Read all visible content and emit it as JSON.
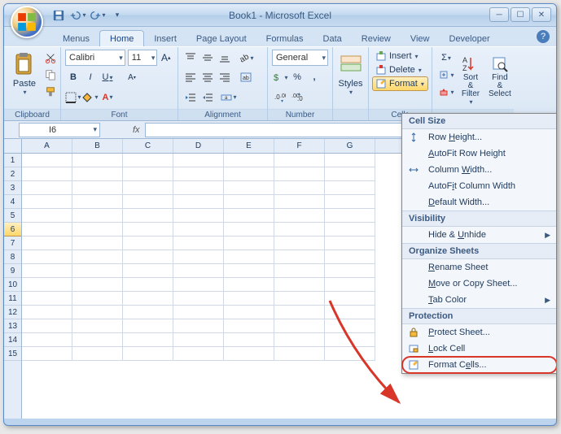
{
  "title": "Book1 - Microsoft Excel",
  "tabs": [
    "Menus",
    "Home",
    "Insert",
    "Page Layout",
    "Formulas",
    "Data",
    "Review",
    "View",
    "Developer"
  ],
  "active_tab": "Home",
  "ribbon": {
    "clipboard": {
      "label": "Clipboard",
      "paste": "Paste"
    },
    "font": {
      "label": "Font",
      "name": "Calibri",
      "size": "11"
    },
    "alignment": {
      "label": "Alignment"
    },
    "number": {
      "label": "Number",
      "format": "General"
    },
    "styles": {
      "label": "Styles"
    },
    "cells": {
      "label": "Cells",
      "insert": "Insert",
      "delete": "Delete",
      "format": "Format"
    },
    "editing": {
      "sort": "Sort & Filter",
      "find": "Find & Select"
    }
  },
  "namebox": "I6",
  "fx": "fx",
  "columns": [
    "A",
    "B",
    "C",
    "D",
    "E",
    "F",
    "G"
  ],
  "rows": [
    "1",
    "2",
    "3",
    "4",
    "5",
    "6",
    "7",
    "8",
    "9",
    "10",
    "11",
    "12",
    "13",
    "14",
    "15"
  ],
  "selected_row": "6",
  "dropdown": {
    "sections": {
      "cell_size": "Cell Size",
      "visibility": "Visibility",
      "organize": "Organize Sheets",
      "protection": "Protection"
    },
    "items": {
      "row_height": "Row Height...",
      "autofit_row": "AutoFit Row Height",
      "col_width": "Column Width...",
      "autofit_col": "AutoFit Column Width",
      "default_width": "Default Width...",
      "hide_unhide": "Hide & Unhide",
      "rename": "Rename Sheet",
      "move_copy": "Move or Copy Sheet...",
      "tab_color": "Tab Color",
      "protect_sheet": "Protect Sheet...",
      "lock_cell": "Lock Cell",
      "format_cells": "Format Cells..."
    }
  }
}
